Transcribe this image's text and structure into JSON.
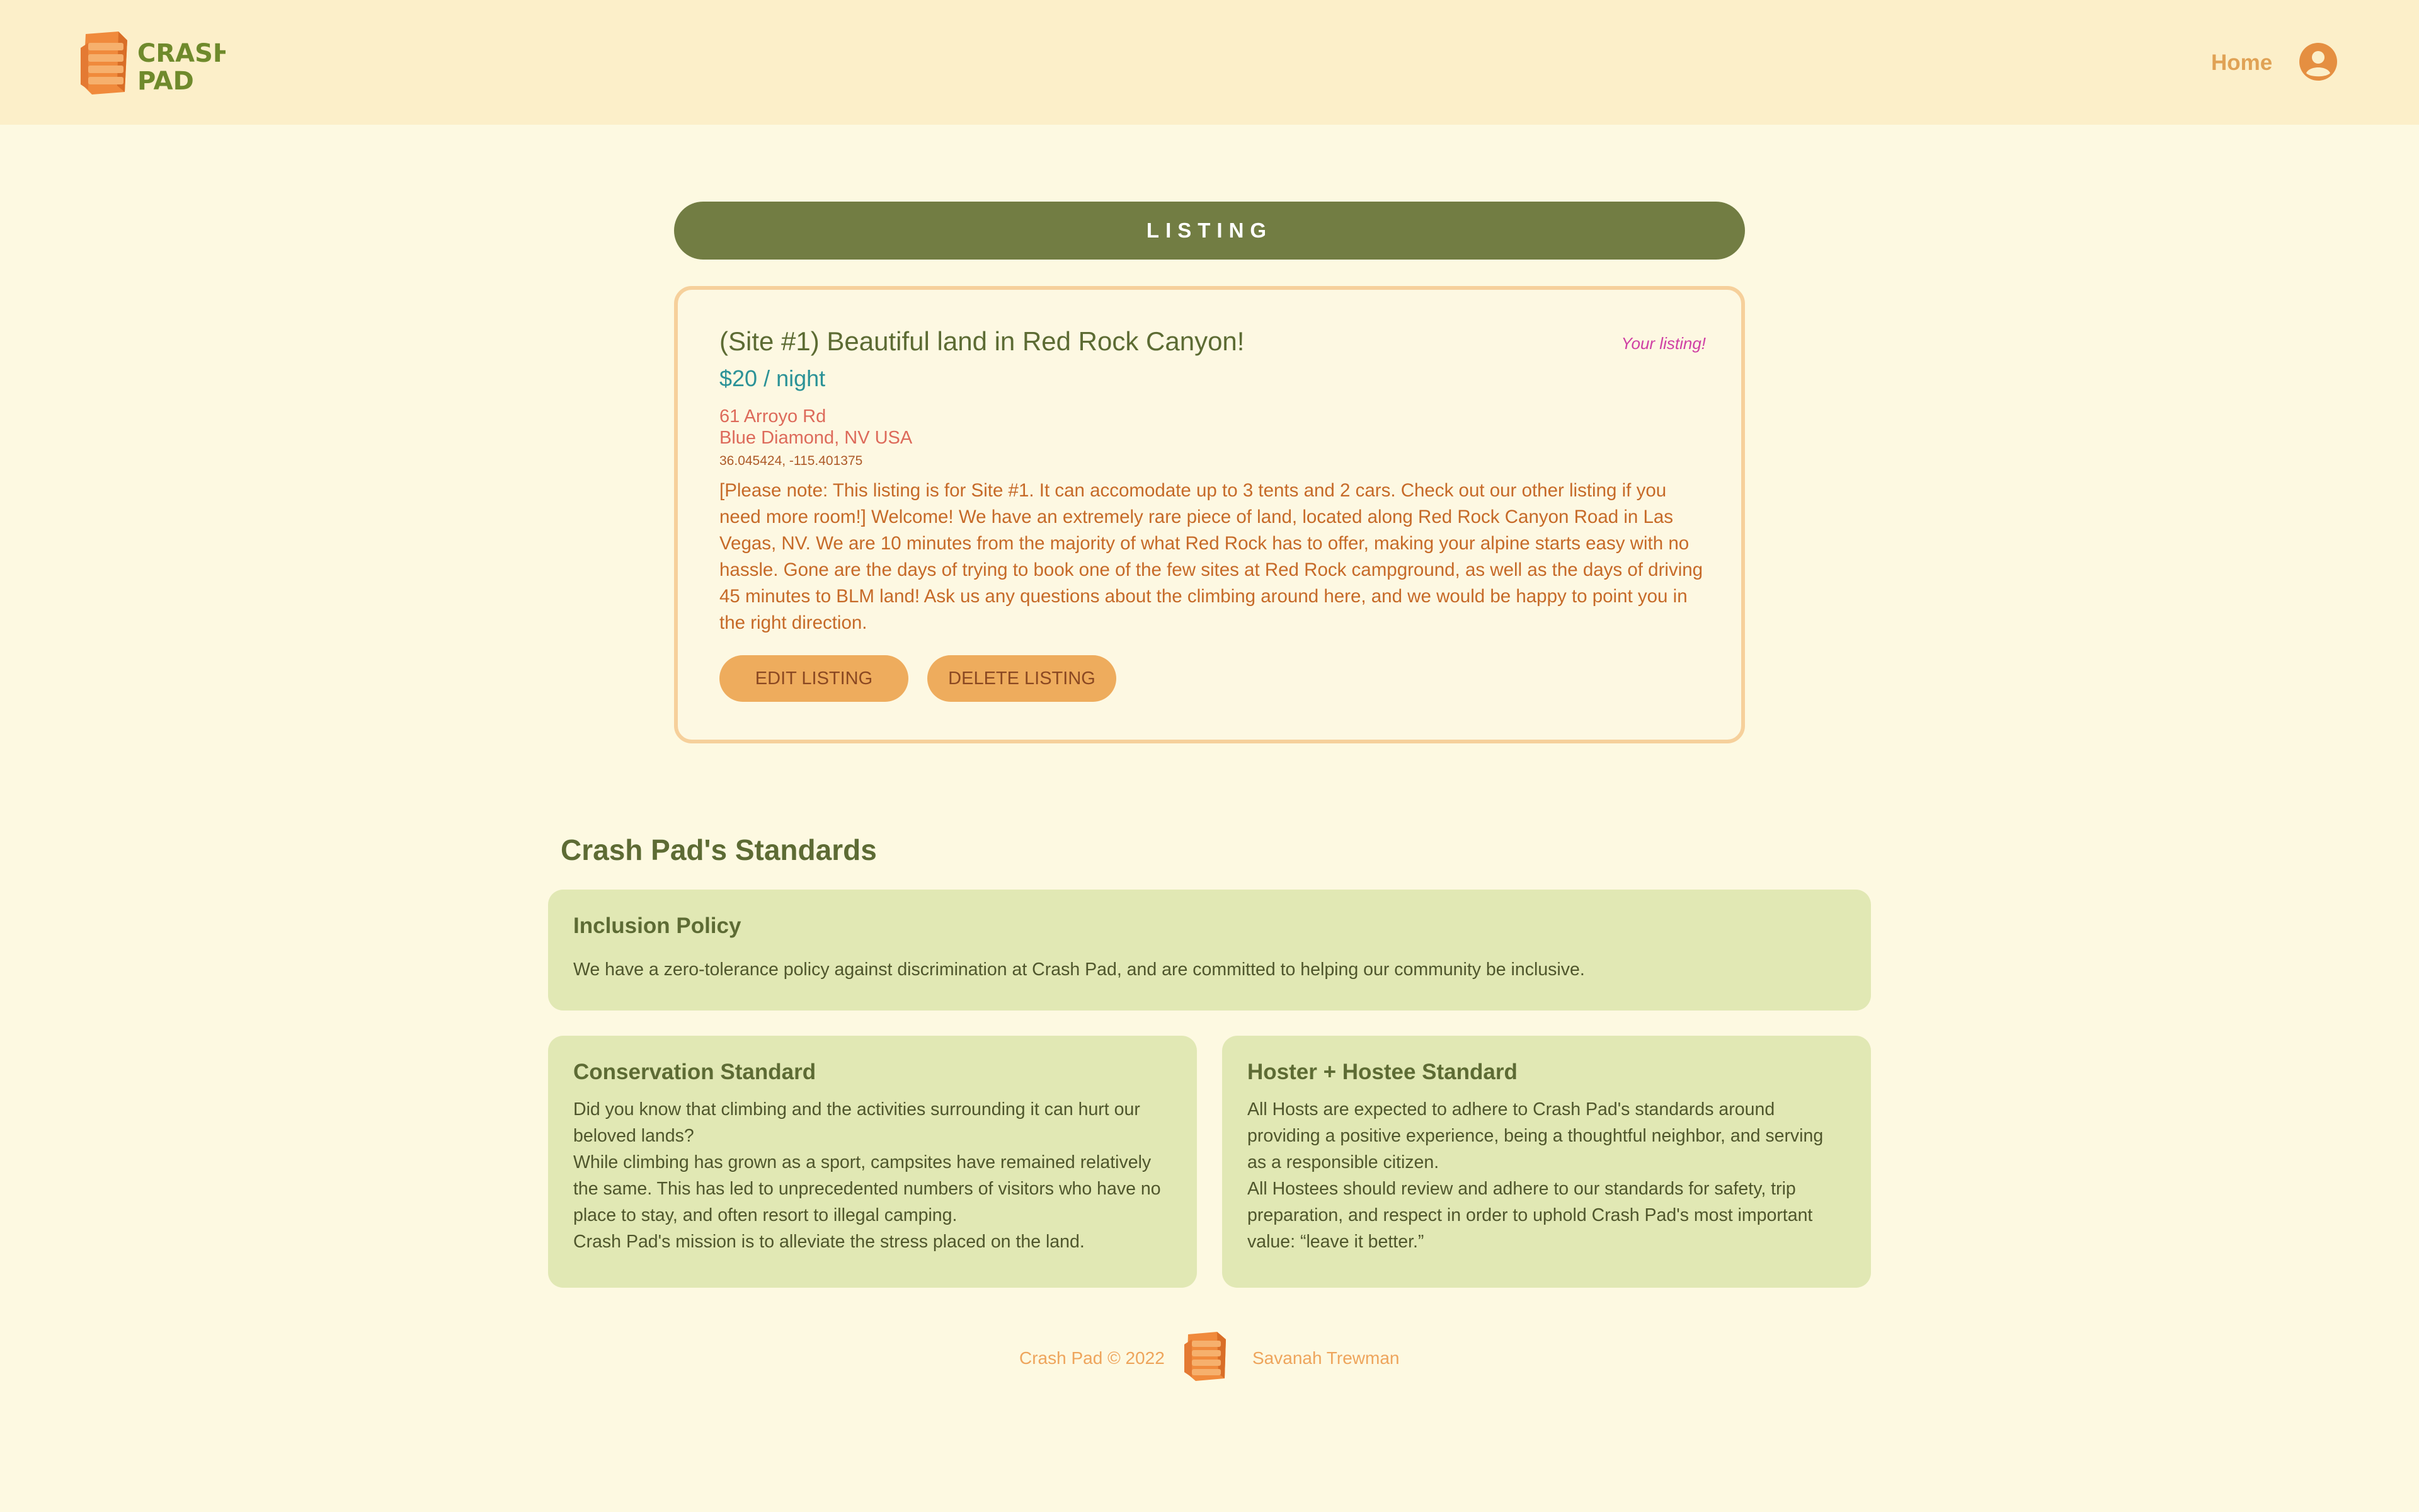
{
  "header": {
    "logo_text_line1": "CRASH",
    "logo_text_line2": "PAD",
    "nav_home": "Home"
  },
  "listing": {
    "section_label": "LISTING",
    "title": "(Site #1) Beautiful land in Red Rock Canyon!",
    "owner_badge": "Your listing!",
    "price": "$20 / night",
    "address_line1": "61 Arroyo Rd",
    "address_line2": "Blue Diamond, NV USA",
    "coordinates": "36.045424, -115.401375",
    "description": "[Please note: This listing is for Site #1. It can accomodate up to 3 tents and 2 cars. Check out our other listing if you need more room!] Welcome! We have an extremely rare piece of land, located along Red Rock Canyon Road in Las Vegas, NV. We are 10 minutes from the majority of what Red Rock has to offer, making your alpine starts easy with no hassle. Gone are the days of trying to book one of the few sites at Red Rock campground, as well as the days of driving 45 minutes to BLM land! Ask us any questions about the climbing around here, and we would be happy to point you in the right direction.",
    "edit_label": "EDIT LISTING",
    "delete_label": "DELETE LISTING"
  },
  "standards": {
    "title": "Crash Pad's Standards",
    "inclusion": {
      "heading": "Inclusion Policy",
      "body": "We have a zero-tolerance policy against discrimination at Crash Pad, and are committed to helping our community be inclusive."
    },
    "conservation": {
      "heading": "Conservation Standard",
      "body_line1": "Did you know that climbing and the activities surrounding it can hurt our beloved lands?",
      "body_line2": "While climbing has grown as a sport, campsites have remained relatively the same. This has led to unprecedented numbers of visitors who have no place to stay, and often resort to illegal camping.",
      "body_line3": "Crash Pad's mission is to alleviate the stress placed on the land."
    },
    "hoster": {
      "heading": "Hoster + Hostee Standard",
      "body_line1": "All Hosts are expected to adhere to Crash Pad's standards around providing a positive experience, being a thoughtful neighbor, and serving as a responsible citizen.",
      "body_line2": "All Hostees should review and adhere to our standards for safety, trip preparation, and respect in order to uphold Crash Pad's most important value: “leave it better.”"
    }
  },
  "footer": {
    "copyright": "Crash Pad © 2022",
    "author": "Savanah Trewman"
  },
  "colors": {
    "page_bg": "#fdf9e1",
    "header_bg": "#fcefc9",
    "accent_green": "#727d43",
    "accent_orange": "#eeac5d",
    "panel_bg": "#e1e8b4",
    "badge_pink": "#cf3fa4",
    "price_teal": "#2b9297"
  },
  "icons": {
    "logo": "crash-pad-logo",
    "avatar": "user-circle-icon",
    "footer_logo": "crash-pad-mat-icon"
  }
}
